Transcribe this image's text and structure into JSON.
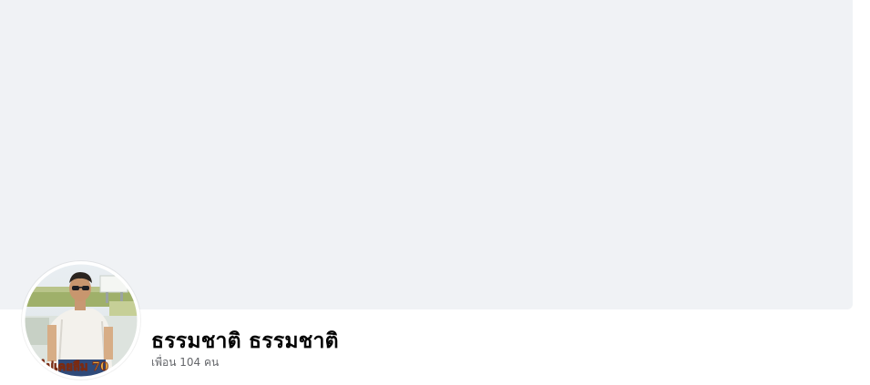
{
  "cover": {
    "color": "#f0f2f5"
  },
  "profile": {
    "name": "ธรรมชาติ ธรรมชาติ",
    "friends_prefix": "เพื่อน",
    "friends_count": "104",
    "friends_suffix": "คน",
    "photo_icon": "person-photo",
    "photo_caption": "ไม่เคยลืม 70"
  },
  "colors": {
    "name_text": "#050505",
    "secondary_text": "#65676b",
    "background": "#ffffff"
  }
}
